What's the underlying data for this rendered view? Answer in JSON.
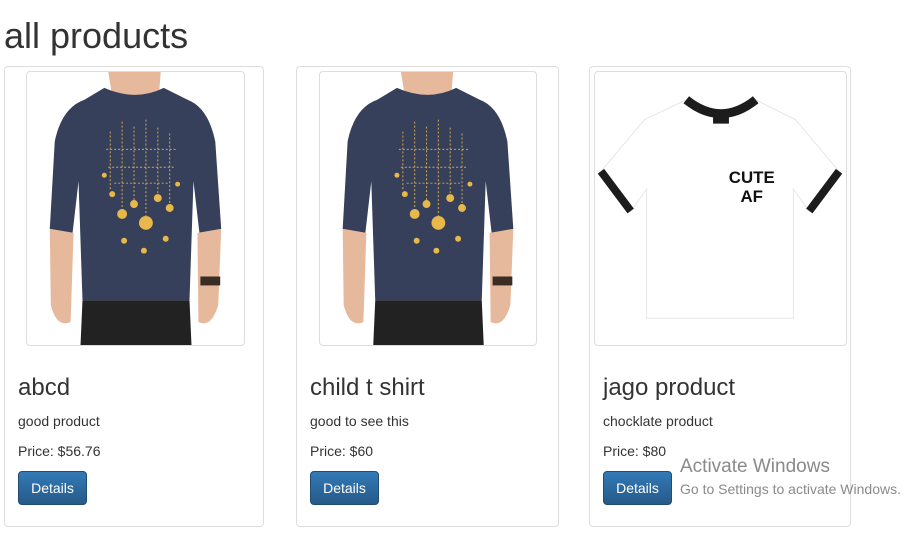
{
  "page": {
    "title": "all products"
  },
  "products": [
    {
      "name": "abcd",
      "description": "good product",
      "price": "Price: $56.76",
      "button": "Details",
      "image": "navy-tshirt-lightbulbs"
    },
    {
      "name": "child t shirt",
      "description": "good to see this",
      "price": "Price: $60",
      "button": "Details",
      "image": "navy-tshirt-lightbulbs"
    },
    {
      "name": "jago product",
      "description": "chocklate product",
      "price": "Price: $80",
      "button": "Details",
      "image": "white-ringer-tshirt",
      "image_text": [
        "CUTE",
        "AF"
      ]
    }
  ],
  "watermark": {
    "title": "Activate Windows",
    "subtitle": "Go to Settings to activate Windows."
  },
  "colors": {
    "button": "#337ab7",
    "shirt_navy": "#37405a",
    "bulb": "#e8b84a"
  }
}
